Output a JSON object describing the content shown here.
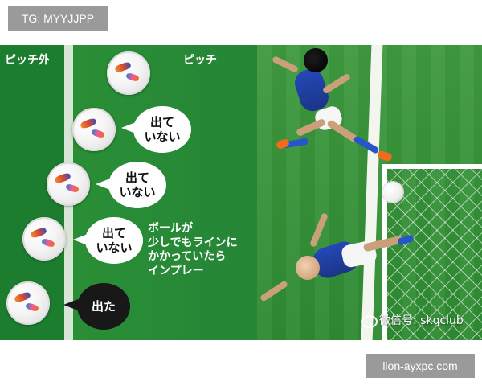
{
  "top_tag": "TG: MYYJJPP",
  "labels": {
    "out": "ピッチ外",
    "in": "ピッチ"
  },
  "bubbles": [
    "出て\nいない",
    "出て\nいない",
    "出て\nいない",
    "出た"
  ],
  "note": "ボールが\n少しでもラインに\nかかっていたら\nインプレー",
  "watermark": "微信号: skqclub",
  "site": "lion-ayxpc.com"
}
